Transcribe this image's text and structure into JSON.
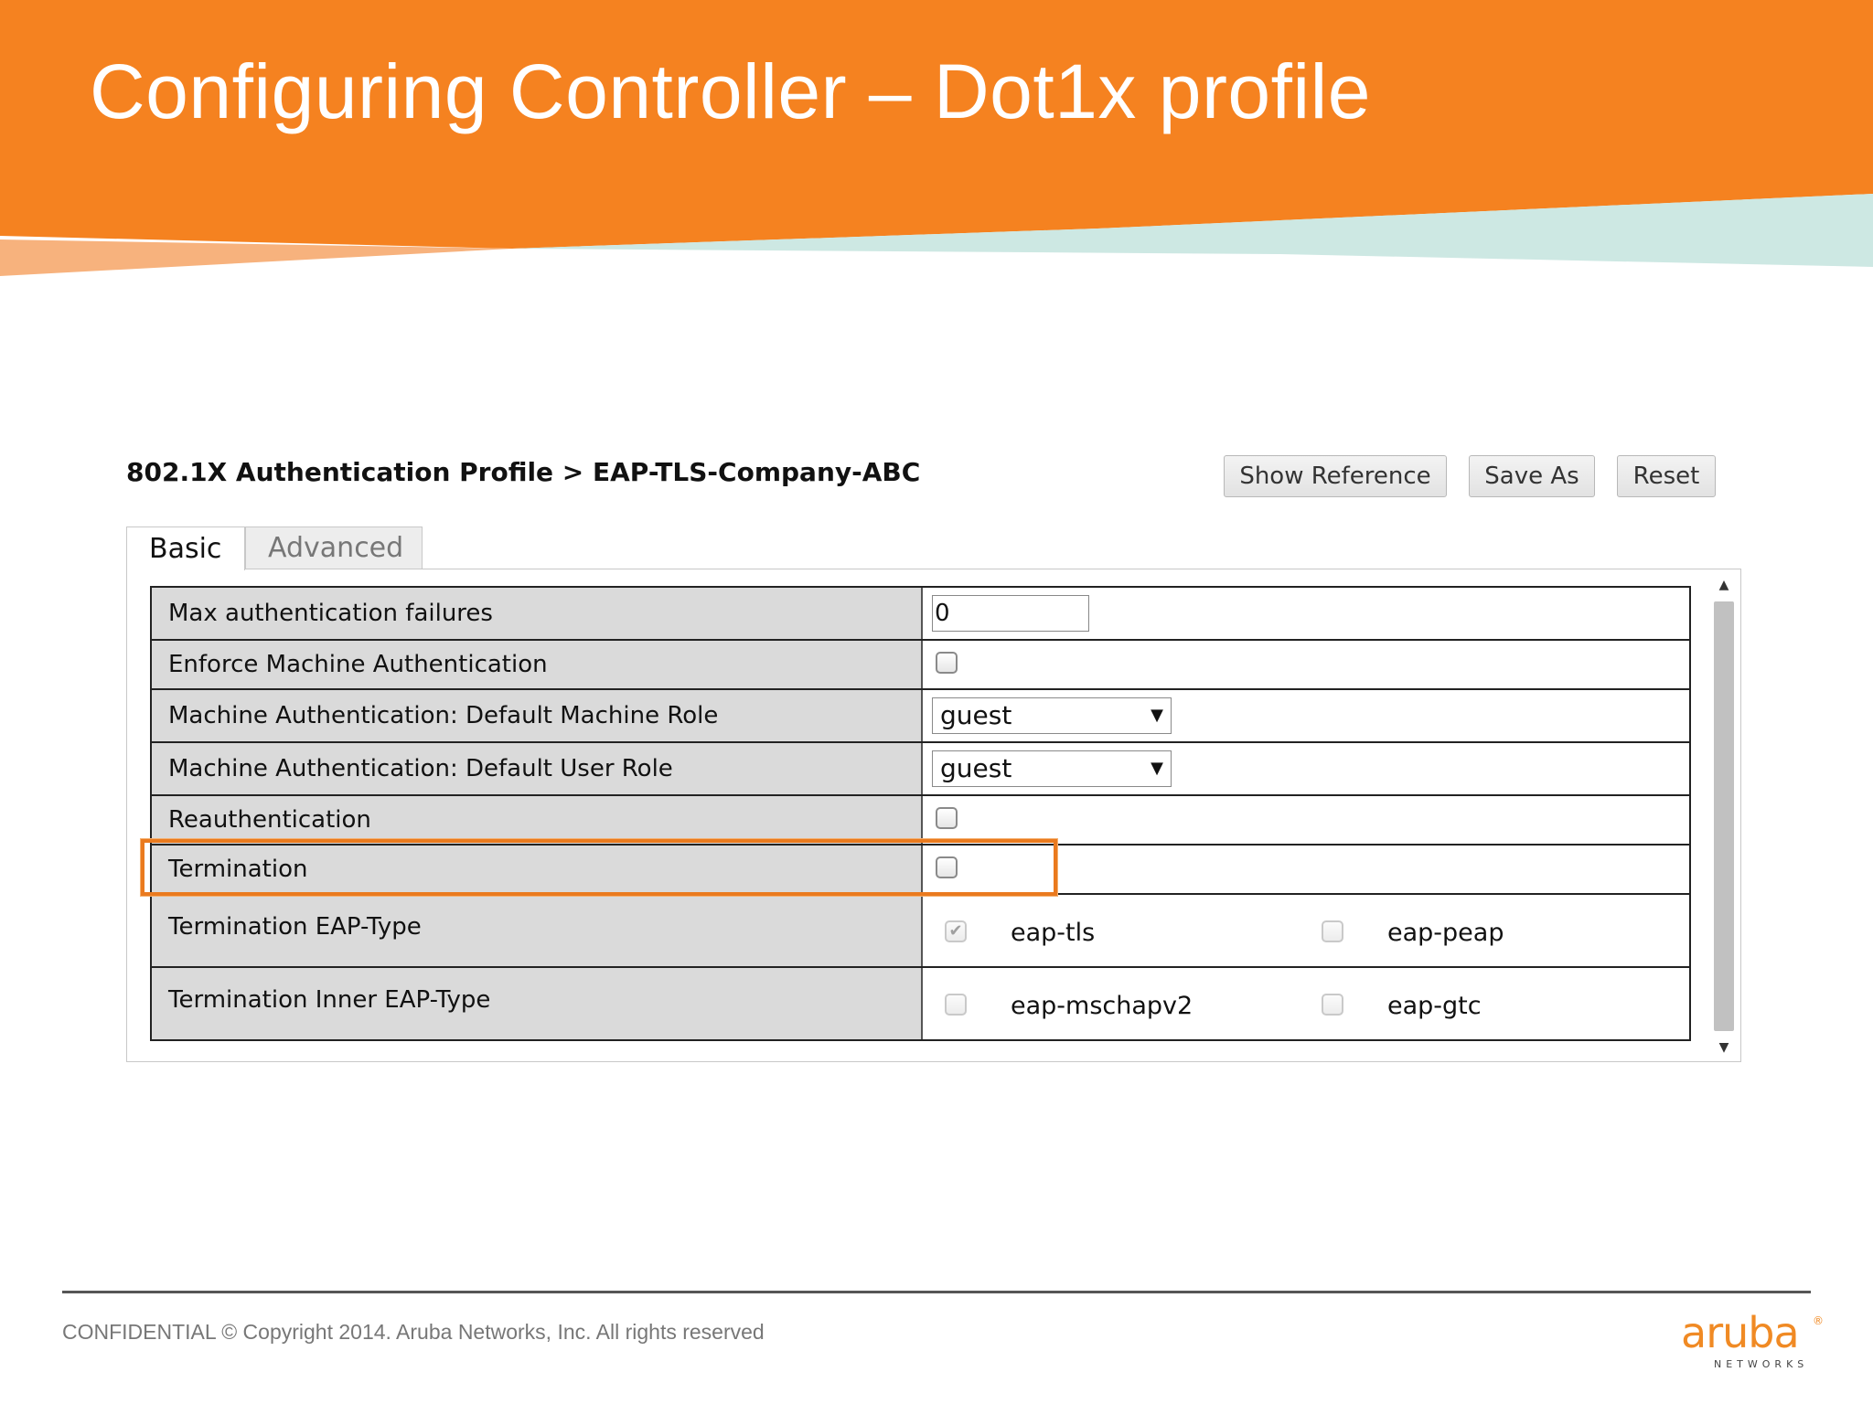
{
  "slide": {
    "title": "Configuring Controller – Dot1x profile"
  },
  "profile": {
    "breadcrumb": "802.1X Authentication Profile > EAP-TLS-Company-ABC",
    "buttons": {
      "show_reference": "Show Reference",
      "save_as": "Save As",
      "reset": "Reset"
    }
  },
  "tabs": {
    "basic": "Basic",
    "advanced": "Advanced",
    "active": "Basic"
  },
  "form": {
    "max_auth_failures": {
      "label": "Max authentication failures",
      "value": "0"
    },
    "enforce_machine_auth": {
      "label": "Enforce Machine Authentication",
      "checked": false
    },
    "machine_role": {
      "label": "Machine Authentication: Default Machine Role",
      "value": "guest"
    },
    "user_role": {
      "label": "Machine Authentication: Default User Role",
      "value": "guest"
    },
    "reauthentication": {
      "label": "Reauthentication",
      "checked": false
    },
    "termination": {
      "label": "Termination",
      "checked": false,
      "highlighted": true
    },
    "termination_eap_type": {
      "label": "Termination EAP-Type",
      "options": [
        {
          "label": "eap-tls",
          "checked": true
        },
        {
          "label": "eap-peap",
          "checked": false
        }
      ]
    },
    "termination_inner_eap_type": {
      "label": "Termination Inner EAP-Type",
      "options": [
        {
          "label": "eap-mschapv2",
          "checked": false
        },
        {
          "label": "eap-gtc",
          "checked": false
        }
      ]
    }
  },
  "footer": {
    "copyright": "CONFIDENTIAL © Copyright 2014. Aruba Networks, Inc. All rights reserved",
    "logo_word": "aruba",
    "logo_sub": "NETWORKS"
  },
  "colors": {
    "banner_orange": "#f58220",
    "highlight_orange": "#ea7a1e",
    "label_bg": "#dadada",
    "logo_orange": "#f08a24"
  },
  "icons": {
    "dropdown": "triangle-down-icon",
    "checked": "checkmark-icon",
    "scroll_up": "triangle-up-icon",
    "scroll_down": "triangle-down-icon"
  }
}
